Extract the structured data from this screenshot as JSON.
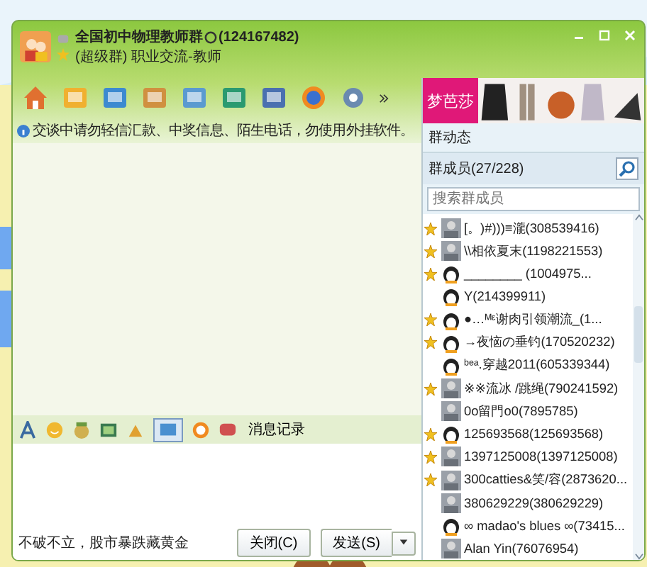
{
  "window": {
    "group_name": "全国初中物理教师群",
    "group_number": "(124167482)",
    "subtitle": "(超级群) 职业交流-教师"
  },
  "notice": "交谈中请勿轻信汇款、中奖信息、陌生电话，勿使用外挂软件。",
  "ad": {
    "brand": "梦芭莎"
  },
  "group_news": "群动态",
  "members_header": "群成员(27/228)",
  "search": {
    "placeholder": "搜索群成员"
  },
  "members": [
    {
      "name": "[。)#)))≡瀧(308539416)",
      "admin": true
    },
    {
      "name": "\\\\相依夏末(1198221553)",
      "admin": true
    },
    {
      "name": "________ (1004975...",
      "admin": true,
      "kind": "penguin"
    },
    {
      "name": "Y(214399911)",
      "admin": false,
      "kind": "penguin"
    },
    {
      "name": "●…ᴹᵋ谢肉引领潮流_(1...",
      "admin": true,
      "kind": "penguin"
    },
    {
      "name": "→夜恼の垂钓(170520232)",
      "admin": true,
      "kind": "penguin"
    },
    {
      "name": "ᵇᵉᵃ.穿越2011(605339344)",
      "admin": false,
      "kind": "penguin"
    },
    {
      "name": "※※流冰 /跳绳(790241592)",
      "admin": true
    },
    {
      "name": "0o留門o0(7895785)",
      "admin": false
    },
    {
      "name": "125693568(125693568)",
      "admin": true,
      "kind": "penguin"
    },
    {
      "name": "1397125008(1397125008)",
      "admin": true
    },
    {
      "name": "300catties&笑/容(2873620...",
      "admin": true
    },
    {
      "name": "380629229(380629229)",
      "admin": false
    },
    {
      "name": "∞ madao's blues ∞(73415...",
      "admin": false,
      "kind": "penguin"
    },
    {
      "name": "Alan Yin(76076954)",
      "admin": false
    }
  ],
  "history_button": "消息记录",
  "status": "不破不立，股市暴跌藏黄金",
  "buttons": {
    "close": "关闭(C)",
    "send": "发送(S)"
  }
}
